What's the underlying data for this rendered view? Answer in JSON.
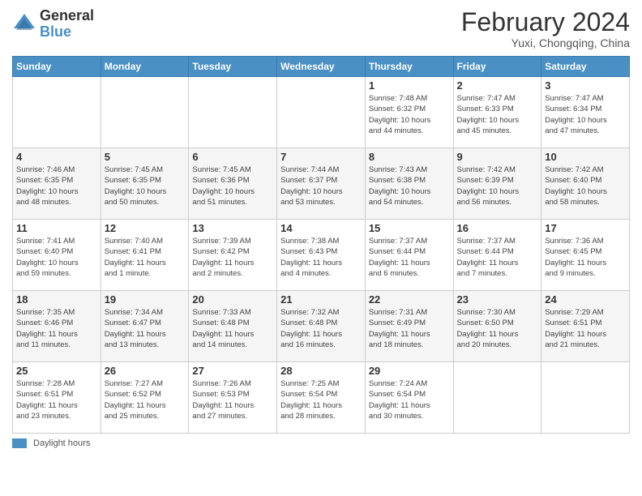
{
  "logo": {
    "general": "General",
    "blue": "Blue"
  },
  "title": {
    "month_year": "February 2024",
    "location": "Yuxi, Chongqing, China"
  },
  "weekdays": [
    "Sunday",
    "Monday",
    "Tuesday",
    "Wednesday",
    "Thursday",
    "Friday",
    "Saturday"
  ],
  "weeks": [
    [
      {
        "day": "",
        "info": ""
      },
      {
        "day": "",
        "info": ""
      },
      {
        "day": "",
        "info": ""
      },
      {
        "day": "",
        "info": ""
      },
      {
        "day": "1",
        "info": "Sunrise: 7:48 AM\nSunset: 6:32 PM\nDaylight: 10 hours\nand 44 minutes."
      },
      {
        "day": "2",
        "info": "Sunrise: 7:47 AM\nSunset: 6:33 PM\nDaylight: 10 hours\nand 45 minutes."
      },
      {
        "day": "3",
        "info": "Sunrise: 7:47 AM\nSunset: 6:34 PM\nDaylight: 10 hours\nand 47 minutes."
      }
    ],
    [
      {
        "day": "4",
        "info": "Sunrise: 7:46 AM\nSunset: 6:35 PM\nDaylight: 10 hours\nand 48 minutes."
      },
      {
        "day": "5",
        "info": "Sunrise: 7:45 AM\nSunset: 6:35 PM\nDaylight: 10 hours\nand 50 minutes."
      },
      {
        "day": "6",
        "info": "Sunrise: 7:45 AM\nSunset: 6:36 PM\nDaylight: 10 hours\nand 51 minutes."
      },
      {
        "day": "7",
        "info": "Sunrise: 7:44 AM\nSunset: 6:37 PM\nDaylight: 10 hours\nand 53 minutes."
      },
      {
        "day": "8",
        "info": "Sunrise: 7:43 AM\nSunset: 6:38 PM\nDaylight: 10 hours\nand 54 minutes."
      },
      {
        "day": "9",
        "info": "Sunrise: 7:42 AM\nSunset: 6:39 PM\nDaylight: 10 hours\nand 56 minutes."
      },
      {
        "day": "10",
        "info": "Sunrise: 7:42 AM\nSunset: 6:40 PM\nDaylight: 10 hours\nand 58 minutes."
      }
    ],
    [
      {
        "day": "11",
        "info": "Sunrise: 7:41 AM\nSunset: 6:40 PM\nDaylight: 10 hours\nand 59 minutes."
      },
      {
        "day": "12",
        "info": "Sunrise: 7:40 AM\nSunset: 6:41 PM\nDaylight: 11 hours\nand 1 minute."
      },
      {
        "day": "13",
        "info": "Sunrise: 7:39 AM\nSunset: 6:42 PM\nDaylight: 11 hours\nand 2 minutes."
      },
      {
        "day": "14",
        "info": "Sunrise: 7:38 AM\nSunset: 6:43 PM\nDaylight: 11 hours\nand 4 minutes."
      },
      {
        "day": "15",
        "info": "Sunrise: 7:37 AM\nSunset: 6:44 PM\nDaylight: 11 hours\nand 6 minutes."
      },
      {
        "day": "16",
        "info": "Sunrise: 7:37 AM\nSunset: 6:44 PM\nDaylight: 11 hours\nand 7 minutes."
      },
      {
        "day": "17",
        "info": "Sunrise: 7:36 AM\nSunset: 6:45 PM\nDaylight: 11 hours\nand 9 minutes."
      }
    ],
    [
      {
        "day": "18",
        "info": "Sunrise: 7:35 AM\nSunset: 6:46 PM\nDaylight: 11 hours\nand 11 minutes."
      },
      {
        "day": "19",
        "info": "Sunrise: 7:34 AM\nSunset: 6:47 PM\nDaylight: 11 hours\nand 13 minutes."
      },
      {
        "day": "20",
        "info": "Sunrise: 7:33 AM\nSunset: 6:48 PM\nDaylight: 11 hours\nand 14 minutes."
      },
      {
        "day": "21",
        "info": "Sunrise: 7:32 AM\nSunset: 6:48 PM\nDaylight: 11 hours\nand 16 minutes."
      },
      {
        "day": "22",
        "info": "Sunrise: 7:31 AM\nSunset: 6:49 PM\nDaylight: 11 hours\nand 18 minutes."
      },
      {
        "day": "23",
        "info": "Sunrise: 7:30 AM\nSunset: 6:50 PM\nDaylight: 11 hours\nand 20 minutes."
      },
      {
        "day": "24",
        "info": "Sunrise: 7:29 AM\nSunset: 6:51 PM\nDaylight: 11 hours\nand 21 minutes."
      }
    ],
    [
      {
        "day": "25",
        "info": "Sunrise: 7:28 AM\nSunset: 6:51 PM\nDaylight: 11 hours\nand 23 minutes."
      },
      {
        "day": "26",
        "info": "Sunrise: 7:27 AM\nSunset: 6:52 PM\nDaylight: 11 hours\nand 25 minutes."
      },
      {
        "day": "27",
        "info": "Sunrise: 7:26 AM\nSunset: 6:53 PM\nDaylight: 11 hours\nand 27 minutes."
      },
      {
        "day": "28",
        "info": "Sunrise: 7:25 AM\nSunset: 6:54 PM\nDaylight: 11 hours\nand 28 minutes."
      },
      {
        "day": "29",
        "info": "Sunrise: 7:24 AM\nSunset: 6:54 PM\nDaylight: 11 hours\nand 30 minutes."
      },
      {
        "day": "",
        "info": ""
      },
      {
        "day": "",
        "info": ""
      }
    ]
  ],
  "legend": {
    "daylight_label": "Daylight hours"
  }
}
